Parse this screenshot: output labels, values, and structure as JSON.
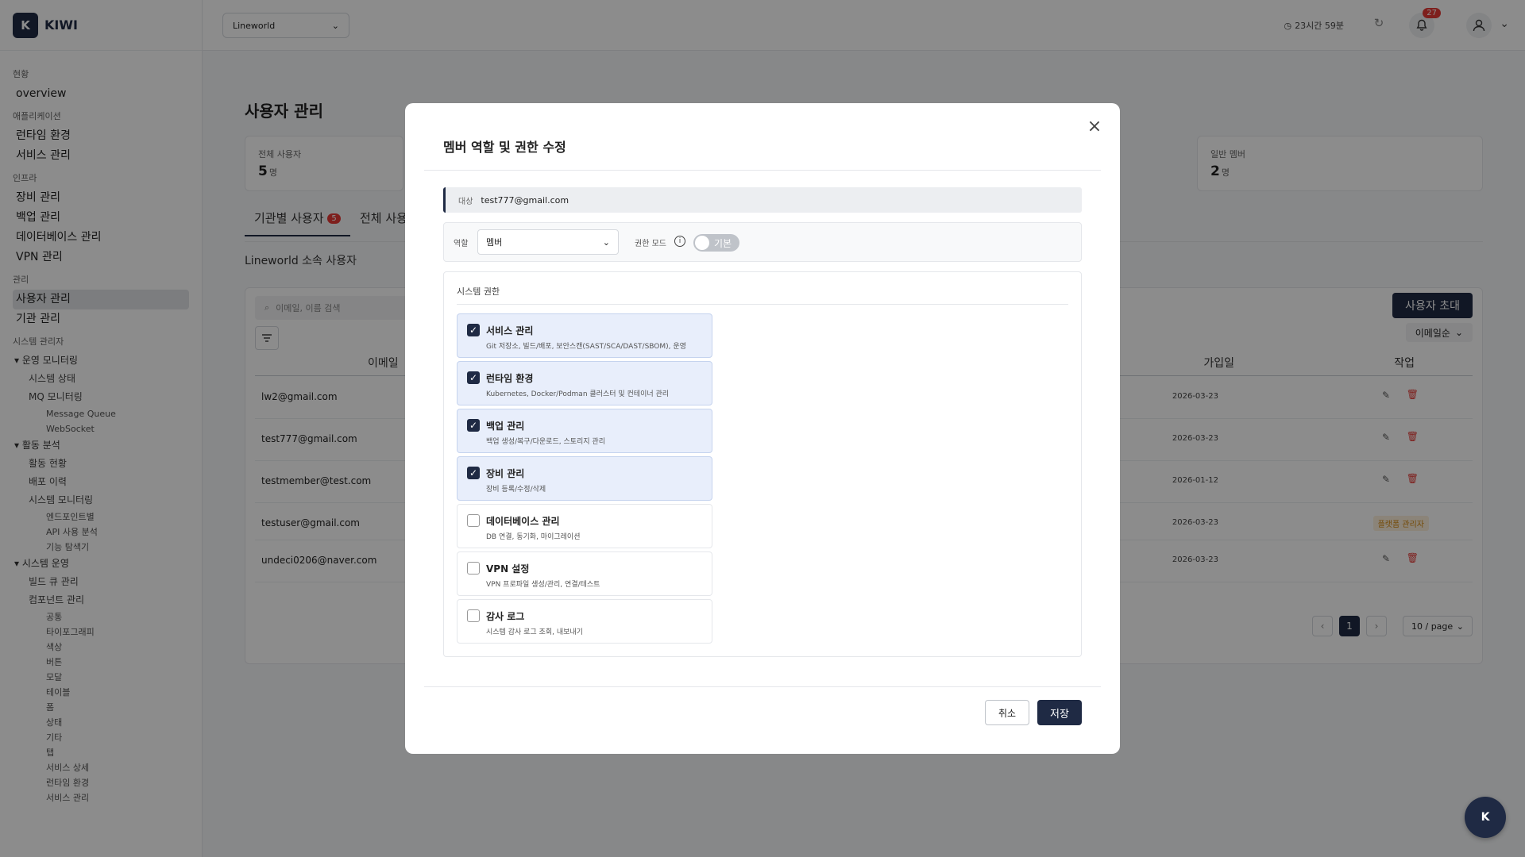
{
  "brand": {
    "logo_letter": "K",
    "name": "KIWI"
  },
  "sidebar": {
    "sec_status": "현황",
    "overview": "overview",
    "sec_app": "애플리케이션",
    "runtime": "런타임 환경",
    "service": "서비스 관리",
    "sec_infra": "인프라",
    "equipment": "장비 관리",
    "backup": "백업 관리",
    "database": "데이터베이스 관리",
    "vpn": "VPN 관리",
    "sec_manage": "관리",
    "users": "사용자 관리",
    "orgs": "기관 관리",
    "sec_sysadmin": "시스템 관리자",
    "g1": "운영 모니터링",
    "g1_a": "시스템 상태",
    "g1_b": "MQ 모니터링",
    "g1_b1": "Message Queue",
    "g1_b2": "WebSocket",
    "g2": "활동 분석",
    "g2_a": "활동 현황",
    "g2_b": "배포 이력",
    "g2_c": "시스템 모니터링",
    "g2_c1": "엔드포인트별",
    "g2_c2": "API 사용 분석",
    "g2_c3": "기능 탐색기",
    "g3": "시스템 운영",
    "g3_a": "빌드 큐 관리",
    "g3_b": "컴포넌트 관리",
    "g3_b_items": [
      "공통",
      "타이포그래피",
      "색상",
      "버튼",
      "모달",
      "테이블",
      "폼",
      "상태",
      "기타",
      "탭",
      "서비스 상세",
      "런타임 환경",
      "서비스 관리"
    ]
  },
  "topbar": {
    "org": "Lineworld",
    "timer": "23시간 59분",
    "notif_count": "27"
  },
  "main": {
    "title": "사용자 관리",
    "stat_total_label": "전체 사용자",
    "stat_total_value": "5",
    "stat_unit": "명",
    "stat_member_label": "일반 멤버",
    "stat_member_value": "2",
    "tab_org": "기관별 사용자",
    "tab_org_count": "5",
    "tab_all": "전체 사용",
    "org_sub": "Lineworld 소속 사용자",
    "search_placeholder": "이메일, 이름 검색",
    "invite": "사용자 초대",
    "sort": "이메일순",
    "th_email": "이메일",
    "th_joined": "가입일",
    "th_action": "작업",
    "rows": [
      {
        "email": "lw2@gmail.com",
        "date": "2026-03-23"
      },
      {
        "email": "test777@gmail.com",
        "date": "2026-03-23"
      },
      {
        "email": "testmember@test.com",
        "date": "2026-01-12"
      },
      {
        "email": "testuser@gmail.com",
        "date": "2026-03-23",
        "badge": "플랫폼 관리자"
      },
      {
        "email": "undeci0206@naver.com",
        "date": "2026-03-23"
      }
    ],
    "page": "1",
    "per_page": "10 / page",
    "fab": "K"
  },
  "modal": {
    "title": "멤버 역할 및 권한 수정",
    "target_label": "대상",
    "target_value": "test777@gmail.com",
    "role_label": "역할",
    "role_value": "멤버",
    "mode_label": "권한 모드",
    "mode_value": "기본",
    "perm_header": "시스템 권한",
    "perms": [
      {
        "title": "서비스 관리",
        "desc": "Git 저장소, 빌드/배포, 보안스캔(SAST/SCA/DAST/SBOM), 운영",
        "checked": true
      },
      {
        "title": "런타임 환경",
        "desc": "Kubernetes, Docker/Podman 클러스터 및 컨테이너 관리",
        "checked": true
      },
      {
        "title": "백업 관리",
        "desc": "백업 생성/복구/다운로드, 스토리지 관리",
        "checked": true
      },
      {
        "title": "장비 관리",
        "desc": "장비 등록/수정/삭제",
        "checked": true
      },
      {
        "title": "데이터베이스 관리",
        "desc": "DB 연결, 동기화, 마이그레이션",
        "checked": false
      },
      {
        "title": "VPN 설정",
        "desc": "VPN 프로파일 생성/관리, 연결/테스트",
        "checked": false
      },
      {
        "title": "감사 로그",
        "desc": "시스템 감사 로그 조회, 내보내기",
        "checked": false
      }
    ],
    "cancel": "취소",
    "save": "저장"
  }
}
